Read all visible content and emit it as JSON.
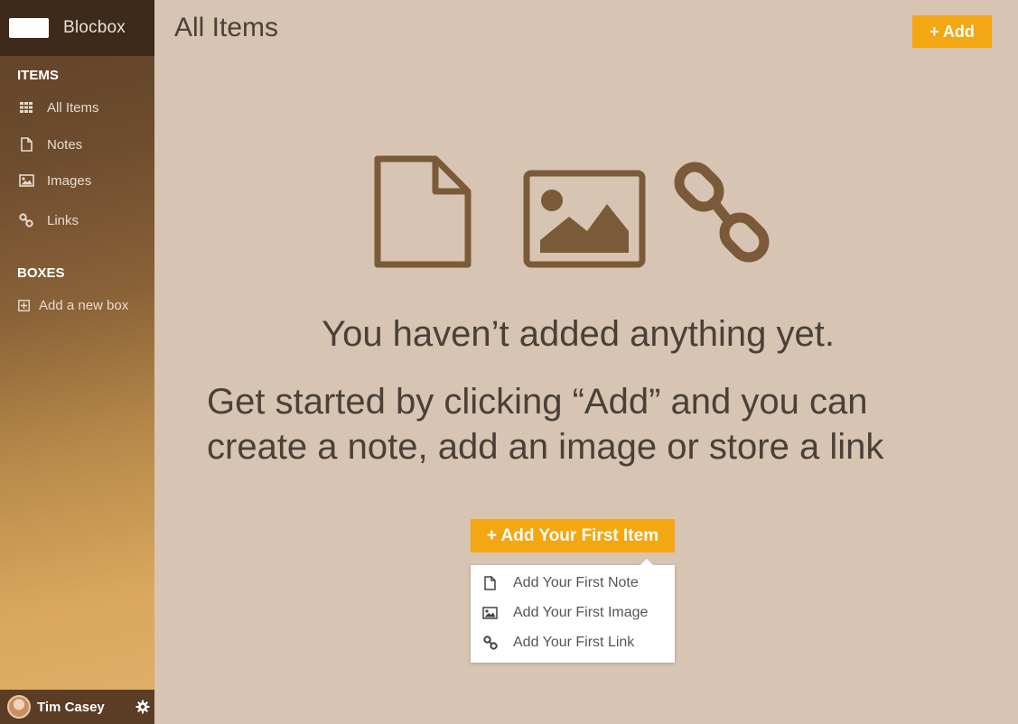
{
  "app": {
    "logo_text": "Blocbox"
  },
  "sidebar": {
    "items_heading": "ITEMS",
    "items": [
      {
        "label": "All Items",
        "icon": "grid-icon"
      },
      {
        "label": "Notes",
        "icon": "note-icon"
      },
      {
        "label": "Images",
        "icon": "image-icon"
      },
      {
        "label": "Links",
        "icon": "link-icon"
      }
    ],
    "boxes_heading": "BOXES",
    "add_box_label": "Add a new box",
    "user": {
      "name": "Tim Casey",
      "settings_icon": "gear-icon"
    }
  },
  "header": {
    "title": "All Items",
    "add_label": "+ Add"
  },
  "empty_state": {
    "icons": [
      "document-icon",
      "image-icon",
      "link-icon"
    ],
    "title": "You haven’t added anything yet.",
    "description": "Get started by clicking “Add” and you can create a note, add an image or store a link",
    "button_label": "+ Add Your First Item",
    "menu": [
      {
        "label": "Add Your First Note",
        "icon": "note-icon"
      },
      {
        "label": "Add Your First Image",
        "icon": "image-icon"
      },
      {
        "label": "Add Your First Link",
        "icon": "link-icon"
      }
    ]
  },
  "colors": {
    "background": "#d8c4b2",
    "accent": "#f3a712",
    "icon_brown": "#7a5a38",
    "text_dark": "#4a4038"
  }
}
